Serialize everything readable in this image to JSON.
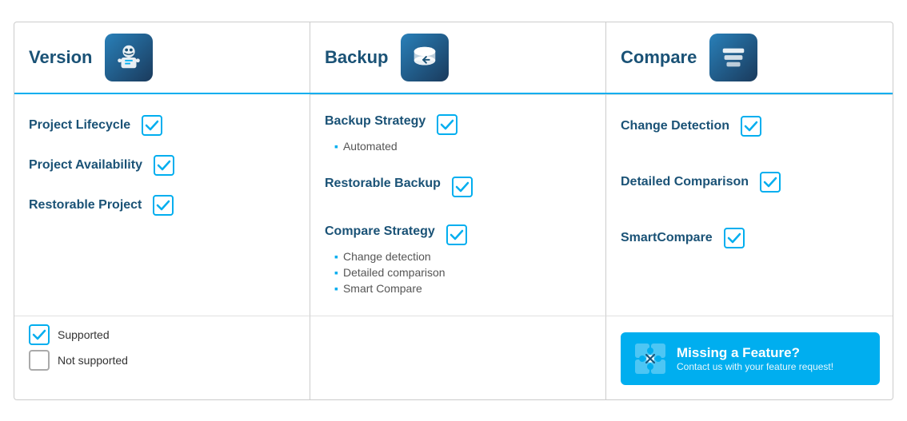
{
  "header": {
    "col1": {
      "title": "Version",
      "icon": "version-icon"
    },
    "col2": {
      "title": "Backup",
      "icon": "backup-icon"
    },
    "col3": {
      "title": "Compare",
      "icon": "compare-icon"
    }
  },
  "version_features": [
    {
      "label": "Project Lifecycle",
      "supported": true
    },
    {
      "label": "Project Availability",
      "supported": true
    },
    {
      "label": "Restorable Project",
      "supported": true
    }
  ],
  "backup_features": [
    {
      "label": "Backup Strategy",
      "supported": true,
      "sub_items": [
        "Automated"
      ]
    },
    {
      "label": "Restorable Backup",
      "supported": true,
      "sub_items": []
    },
    {
      "label": "Compare Strategy",
      "supported": true,
      "sub_items": [
        "Change detection",
        "Detailed comparison",
        "Smart Compare"
      ]
    }
  ],
  "compare_features": [
    {
      "label": "Change Detection",
      "supported": true
    },
    {
      "label": "Detailed Comparison",
      "supported": true
    },
    {
      "label": "SmartCompare",
      "supported": true
    }
  ],
  "legend": {
    "supported_label": "Supported",
    "not_supported_label": "Not supported"
  },
  "missing_banner": {
    "title": "Missing a Feature?",
    "subtitle": "Contact us with your feature request!"
  }
}
